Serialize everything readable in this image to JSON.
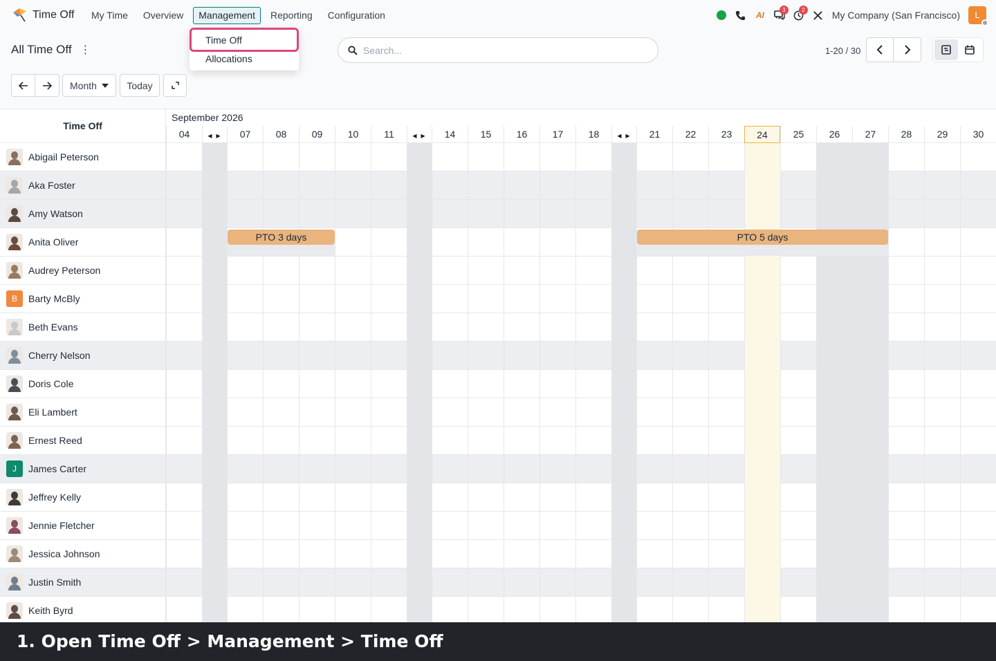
{
  "app": {
    "title": "Time Off",
    "menu": [
      "My Time",
      "Overview",
      "Management",
      "Reporting",
      "Configuration"
    ],
    "active_menu": "Management"
  },
  "systray": {
    "messages_badge": "3",
    "activity_badge": "2",
    "ai_label": "AI",
    "company": "My Company (San Francisco)",
    "user_initial": "L"
  },
  "dropdown": {
    "items": [
      "Time Off",
      "Allocations"
    ]
  },
  "control": {
    "breadcrumb": "All Time Off",
    "search_placeholder": "Search...",
    "pager": "1-20 / 30",
    "scale": "Month",
    "today": "Today"
  },
  "gantt": {
    "header": "Time Off",
    "month": "September 2026",
    "days": [
      "04",
      "07",
      "08",
      "09",
      "10",
      "11",
      "14",
      "15",
      "16",
      "17",
      "18",
      "21",
      "22",
      "23",
      "24",
      "25",
      "26",
      "27",
      "28",
      "29",
      "30"
    ],
    "today": "24",
    "employees": [
      {
        "name": "Abigail Peterson"
      },
      {
        "name": "Aka Foster"
      },
      {
        "name": "Amy Watson"
      },
      {
        "name": "Anita Oliver"
      },
      {
        "name": "Audrey Peterson"
      },
      {
        "name": "Barty McBly",
        "initial": "B"
      },
      {
        "name": "Beth Evans"
      },
      {
        "name": "Cherry Nelson"
      },
      {
        "name": "Doris Cole"
      },
      {
        "name": "Eli Lambert"
      },
      {
        "name": "Ernest Reed"
      },
      {
        "name": "James Carter",
        "initial": "J"
      },
      {
        "name": "Jeffrey Kelly"
      },
      {
        "name": "Jennie Fletcher"
      },
      {
        "name": "Jessica Johnson"
      },
      {
        "name": "Justin Smith"
      },
      {
        "name": "Keith Byrd"
      }
    ],
    "pills": [
      {
        "label": "PTO 3 days",
        "employee": "Anita Oliver",
        "from": "07",
        "to": "09"
      },
      {
        "label": "PTO 5 days",
        "employee": "Anita Oliver",
        "from": "21",
        "to": "27"
      }
    ]
  },
  "caption": "1. Open Time Off > Management > Time Off"
}
